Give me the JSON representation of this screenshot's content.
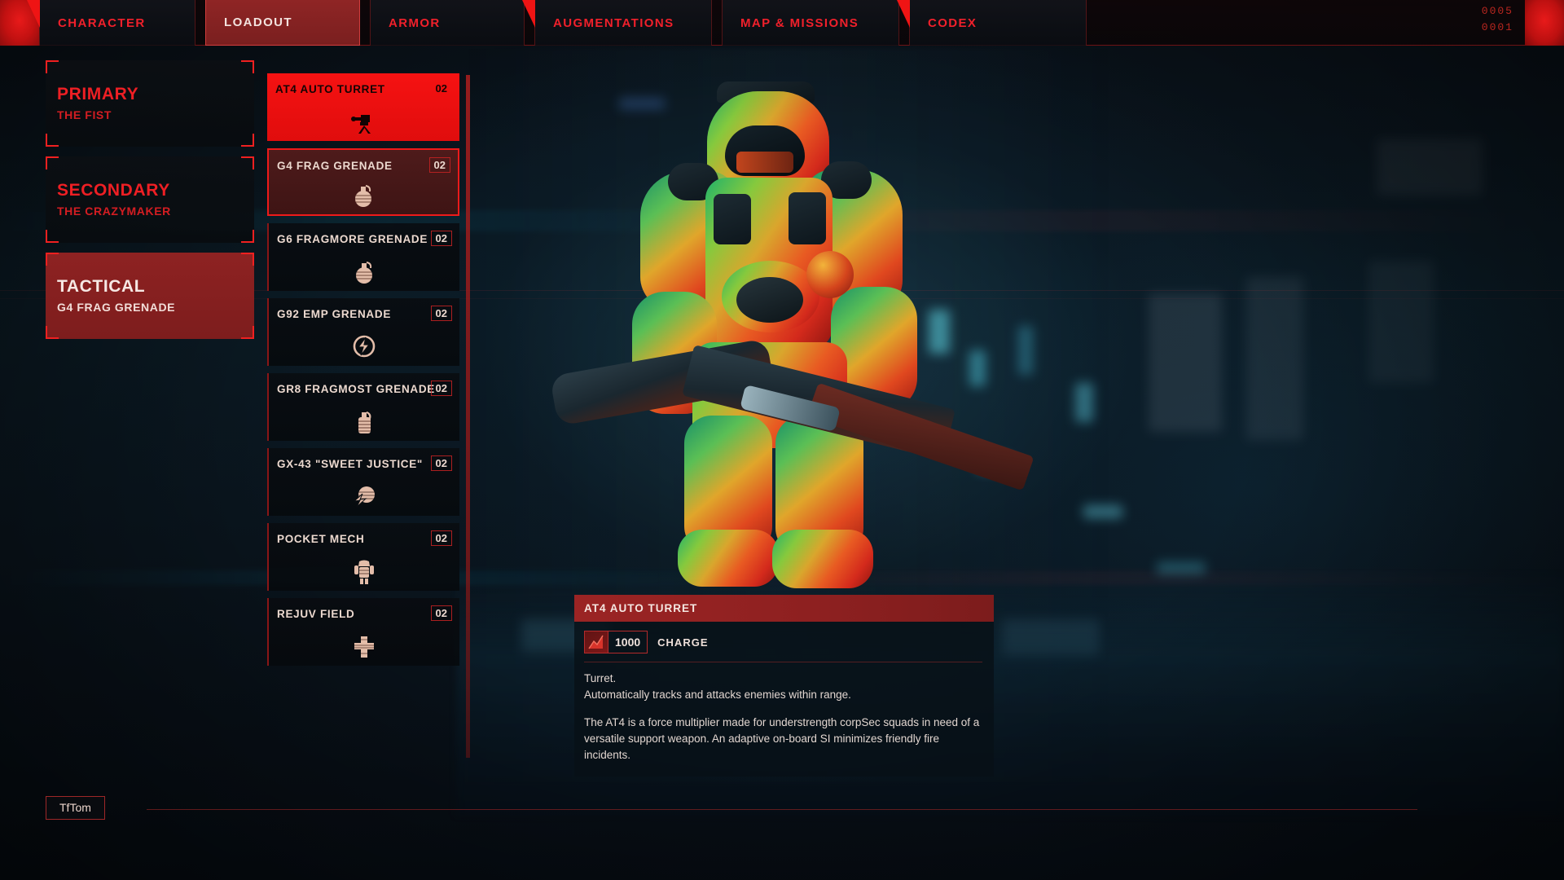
{
  "nav": {
    "tabs": [
      {
        "label": "CHARACTER",
        "active": false
      },
      {
        "label": "LOADOUT",
        "active": true
      },
      {
        "label": "ARMOR",
        "active": false
      },
      {
        "label": "AUGMENTATIONS",
        "active": false
      },
      {
        "label": "MAP & MISSIONS",
        "active": false
      },
      {
        "label": "CODEX",
        "active": false
      }
    ],
    "counter_top": "0005",
    "counter_bottom": "0001"
  },
  "slots": [
    {
      "title": "PRIMARY",
      "item": "THE FIST",
      "equipped": false
    },
    {
      "title": "SECONDARY",
      "item": "THE CRAZYMAKER",
      "equipped": false
    },
    {
      "title": "TACTICAL",
      "item": "G4 FRAG GRENADE",
      "equipped": true
    }
  ],
  "items": [
    {
      "name": "AT4 AUTO TURRET",
      "qty": "02",
      "icon": "turret-icon",
      "state": "hovered"
    },
    {
      "name": "G4 FRAG GRENADE",
      "qty": "02",
      "icon": "grenade-icon",
      "state": "selected"
    },
    {
      "name": "G6 FRAGMORE GRENADE",
      "qty": "02",
      "icon": "grenade-icon",
      "state": "normal"
    },
    {
      "name": "G92 EMP GRENADE",
      "qty": "02",
      "icon": "emp-icon",
      "state": "normal"
    },
    {
      "name": "GR8 FRAGMOST GRENADE",
      "qty": "02",
      "icon": "canister-icon",
      "state": "normal"
    },
    {
      "name": "GX-43 \"SWEET JUSTICE\"",
      "qty": "02",
      "icon": "shockwave-icon",
      "state": "normal"
    },
    {
      "name": "POCKET MECH",
      "qty": "02",
      "icon": "mech-icon",
      "state": "normal"
    },
    {
      "name": "REJUV FIELD",
      "qty": "02",
      "icon": "medcross-icon",
      "state": "normal"
    }
  ],
  "detail": {
    "title": "AT4 AUTO TURRET",
    "stat_icon": "charge-icon",
    "stat_value": "1000",
    "stat_label": "CHARGE",
    "description_1": "Turret.\nAutomatically tracks and attacks enemies within range.",
    "description_2": "The AT4 is a force multiplier made for understrength corpSec squads in need of a versatile support weapon. An adaptive on-board SI minimizes friendly fire incidents."
  },
  "footer": {
    "tag": "TfTom"
  },
  "colors": {
    "accent_red": "#ee1f24",
    "bright_red": "#f61212",
    "panel_dark": "#090c10",
    "slot_equipped": "#8e2222",
    "text_warm": "#ecd9cf"
  }
}
